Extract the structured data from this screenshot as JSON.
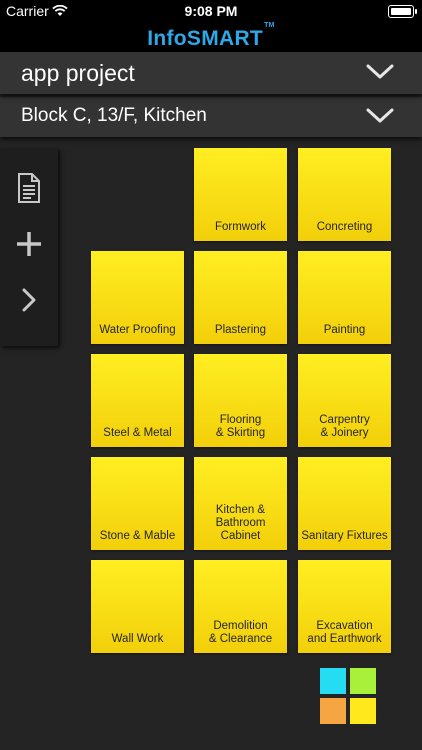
{
  "status_bar": {
    "carrier": "Carrier",
    "time": "9:08 PM"
  },
  "brand": {
    "name": "InfoSMART",
    "trademark": "TM",
    "color": "#2fa8e8"
  },
  "project_selector": {
    "value": "app project"
  },
  "location_selector": {
    "value": "Block C, 13/F, Kitchen"
  },
  "toolbar": {
    "icons": [
      "document-icon",
      "add-icon",
      "chevron-right-icon"
    ]
  },
  "tiles": {
    "formwork": "Formwork",
    "concreting": "Concreting",
    "water_proofing": "Water Proofing",
    "plastering": "Plastering",
    "painting": "Painting",
    "steel_metal": "Steel & Metal",
    "flooring_skirting": "Flooring\n& Skirting",
    "carpentry_joinery": "Carpentry\n& Joinery",
    "stone_mable": "Stone & Mable",
    "kitchen_bathroom_cabinet": "Kitchen &\nBathroom\nCabinet",
    "sanitary_fixtures": "Sanitary Fixtures",
    "wall_work": "Wall Work",
    "demolition_clearance": "Demolition\n& Clearance",
    "excavation_earthwork": "Excavation\nand Earthwork"
  },
  "colors": {
    "tile_yellow": "#ffe81c",
    "background": "#242424",
    "logo_squares": [
      "#26dcf2",
      "#a8f03a",
      "#f5a642",
      "#ffe81c"
    ]
  }
}
